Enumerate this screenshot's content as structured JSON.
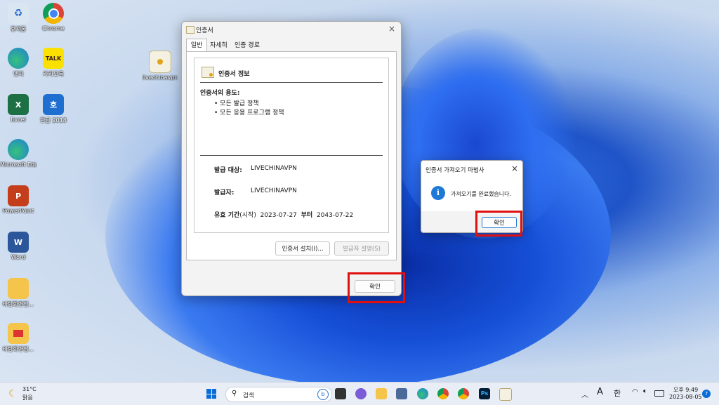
{
  "desktop": {
    "icons": [
      {
        "label": "휴지통"
      },
      {
        "label": "Chrome"
      },
      {
        "label": "엣지"
      },
      {
        "label": "카카오톡"
      },
      {
        "label": "Excel"
      },
      {
        "label": "한글 2018"
      },
      {
        "label": "Microsoft Edge"
      },
      {
        "label": "PowerPoint"
      },
      {
        "label": "Word"
      },
      {
        "label": "바탕화면정..."
      },
      {
        "label": "바탕화면정..."
      },
      {
        "label": "livechinavpn"
      }
    ]
  },
  "cert_window": {
    "title": "인증서",
    "tabs": [
      "일반",
      "자세히",
      "인증 경로"
    ],
    "info_title": "인증서 정보",
    "purpose_heading": "인증서의 용도:",
    "purposes": [
      "모든 발급 정책",
      "모든 응용 프로그램 정책"
    ],
    "issued_to_label": "발급 대상:",
    "issued_to_value": "LIVECHINAVPN",
    "issued_by_label": "발급자:",
    "issued_by_value": "LIVECHINAVPN",
    "validity_label": "유효 기간",
    "validity_start_note": "(시작)",
    "validity_from": "2023-07-27",
    "validity_to_word": "부터",
    "validity_to": "2043-07-22",
    "install_button": "인증서 설치(I)...",
    "issuer_statement_button": "발급자 설명(S)",
    "ok_button": "확인"
  },
  "wizard_dialog": {
    "title": "인증서 가져오기 마법사",
    "message": "가져오기를 완료했습니다.",
    "ok_button": "확인"
  },
  "taskbar": {
    "weather_temp": "31°C",
    "weather_desc": "맑음",
    "search_placeholder": "검색",
    "lang_a": "A",
    "lang_ko": "한",
    "time": "오후 9:49",
    "date": "2023-08-05",
    "notification_count": "7"
  },
  "colors": {
    "highlight_red": "#e01010",
    "info_blue": "#1e78d6"
  }
}
